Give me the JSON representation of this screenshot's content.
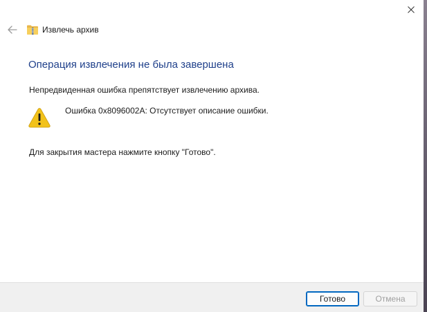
{
  "window": {
    "title": "Извлечь архив",
    "icons": {
      "close": "close-icon",
      "back": "back-arrow-icon",
      "title": "zip-folder-icon",
      "warning": "warning-icon"
    }
  },
  "content": {
    "heading": "Операция извлечения не была завершена",
    "message": "Непредвиденная ошибка препятствует извлечению архива.",
    "error_text": "Ошибка 0x8096002A: Отсутствует описание ошибки.",
    "hint": "Для закрытия мастера нажмите кнопку \"Готово\"."
  },
  "footer": {
    "done_label": "Готово",
    "cancel_label": "Отмена"
  },
  "colors": {
    "heading": "#1e3f8a",
    "accent": "#0067c0",
    "warning": "#f2c21b"
  }
}
